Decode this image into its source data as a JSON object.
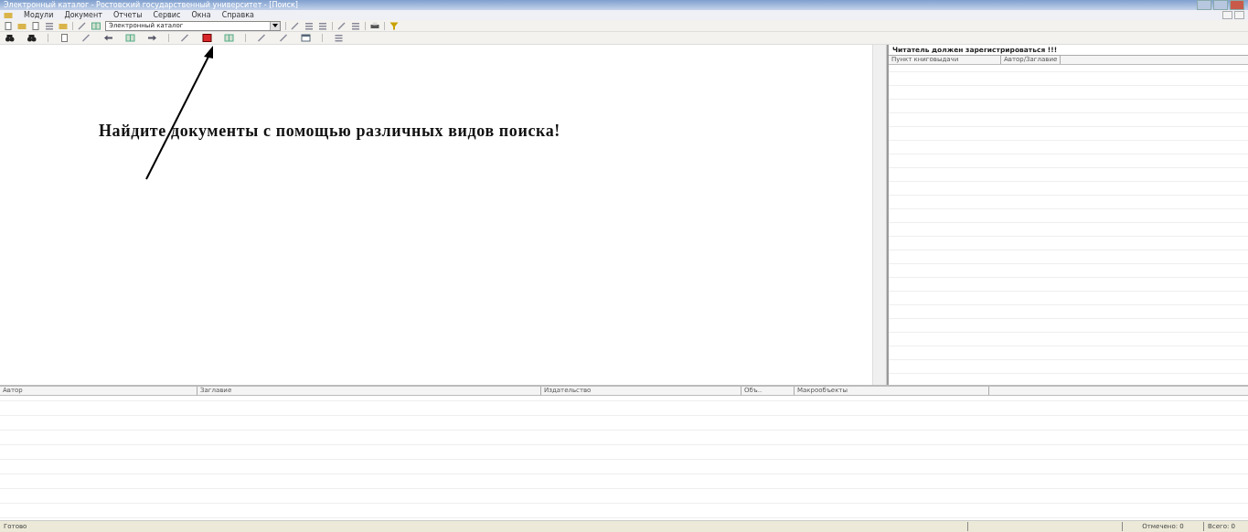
{
  "window": {
    "title": "Электронный каталог - Ростовский государственный университет - [Поиск]"
  },
  "menu": [
    "Модули",
    "Документ",
    "Отчеты",
    "Сервис",
    "Окна",
    "Справка"
  ],
  "toolbar": {
    "catalog_select": {
      "value": "Электронный каталог"
    }
  },
  "search_pane": {
    "message": "Найдите документы с помощью различных видов поиска!"
  },
  "reader_panel": {
    "header": "Читатель должен зарегистрироваться !!!",
    "columns": [
      "Пункт книговыдачи",
      "Автор/Заглавие"
    ]
  },
  "results_table": {
    "columns": [
      "Автор",
      "Заглавие",
      "Издательство",
      "Объ..",
      "Макрообъекты"
    ]
  },
  "status_bar": {
    "message": "Готово",
    "marked": "Отмечено: 0",
    "total": "Всего: 0"
  }
}
